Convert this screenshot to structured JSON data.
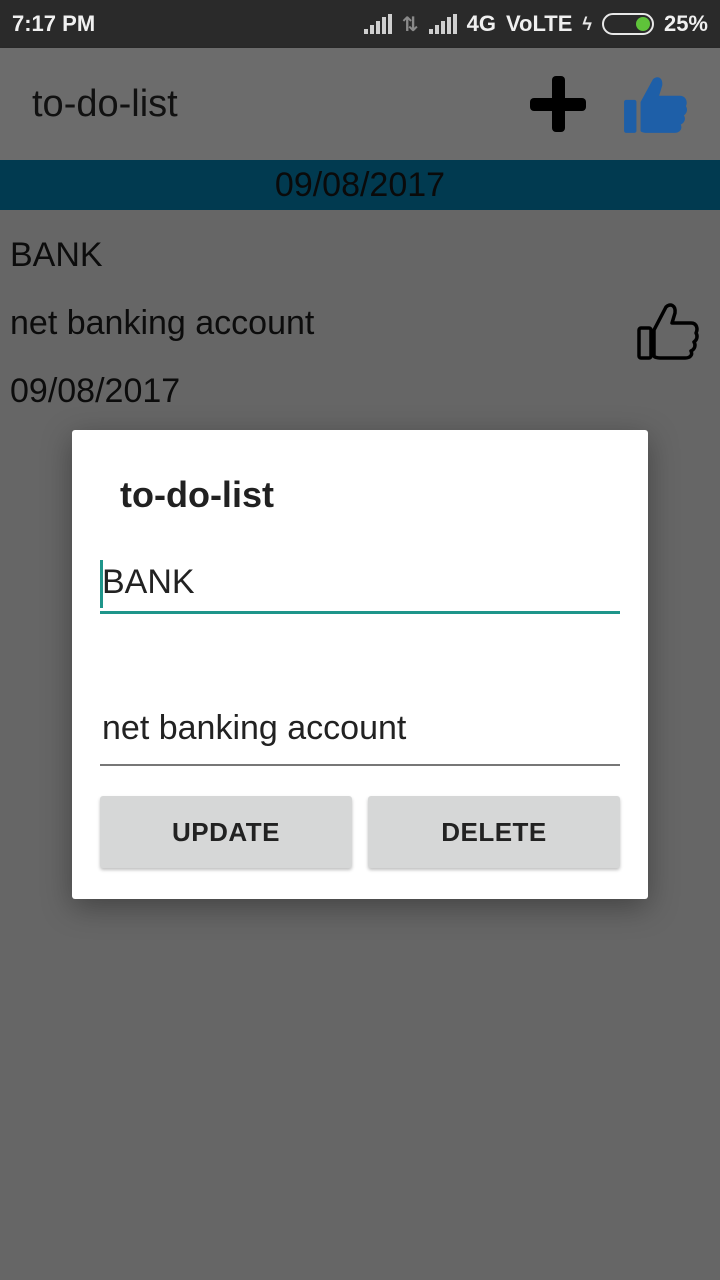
{
  "status_bar": {
    "time": "7:17 PM",
    "network_type": "4G",
    "volte": "VoLTE",
    "battery_percent": "25%",
    "battery_color": "#5fc33a",
    "icons": [
      "signal-icon",
      "data-arrows-icon",
      "signal-icon",
      "charging-bolt-icon",
      "battery-icon"
    ]
  },
  "app_bar": {
    "title": "to-do-list",
    "actions": [
      {
        "icon": "plus-icon"
      },
      {
        "icon": "thumbs-up-icon",
        "color": "#1e5fa8"
      }
    ]
  },
  "list": {
    "date_header": "09/08/2017",
    "header_color": "#013a50",
    "items": [
      {
        "title": "BANK",
        "description": "net banking account",
        "date": "09/08/2017",
        "icon": "thumbs-up-outline-icon"
      }
    ]
  },
  "dialog": {
    "title": "to-do-list",
    "title_field_value": "BANK",
    "description_field_value": "net banking account",
    "accent_color": "#1e958a",
    "update_label": "UPDATE",
    "delete_label": "DELETE"
  }
}
